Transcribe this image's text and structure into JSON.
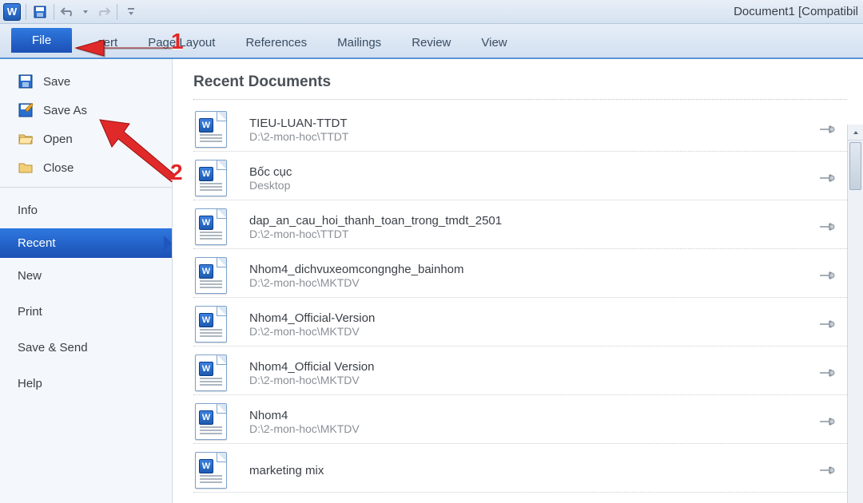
{
  "title": "Document1 [Compatibil",
  "ribbon": {
    "file": "File",
    "tabs": [
      "sert",
      "Page Layout",
      "References",
      "Mailings",
      "Review",
      "View"
    ]
  },
  "sidebar": {
    "icon_items": [
      {
        "label": "Save"
      },
      {
        "label": "Save As"
      },
      {
        "label": "Open"
      },
      {
        "label": "Close"
      }
    ],
    "text_items": [
      "Info",
      "Recent",
      "New",
      "Print",
      "Save & Send",
      "Help"
    ],
    "selected": "Recent"
  },
  "main": {
    "heading": "Recent Documents",
    "docs": [
      {
        "name": "TIEU-LUAN-TTDT",
        "path": "D:\\2-mon-hoc\\TTDT"
      },
      {
        "name": "Bốc cục",
        "path": "Desktop"
      },
      {
        "name": "dap_an_cau_hoi_thanh_toan_trong_tmdt_2501",
        "path": "D:\\2-mon-hoc\\TTDT"
      },
      {
        "name": "Nhom4_dichvuxeomcongnghe_bainhom",
        "path": "D:\\2-mon-hoc\\MKTDV"
      },
      {
        "name": "Nhom4_Official-Version",
        "path": "D:\\2-mon-hoc\\MKTDV"
      },
      {
        "name": "Nhom4_Official Version",
        "path": "D:\\2-mon-hoc\\MKTDV"
      },
      {
        "name": "Nhom4",
        "path": "D:\\2-mon-hoc\\MKTDV"
      },
      {
        "name": "marketing mix",
        "path": ""
      }
    ]
  },
  "annotations": {
    "one": "1",
    "two": "2"
  }
}
